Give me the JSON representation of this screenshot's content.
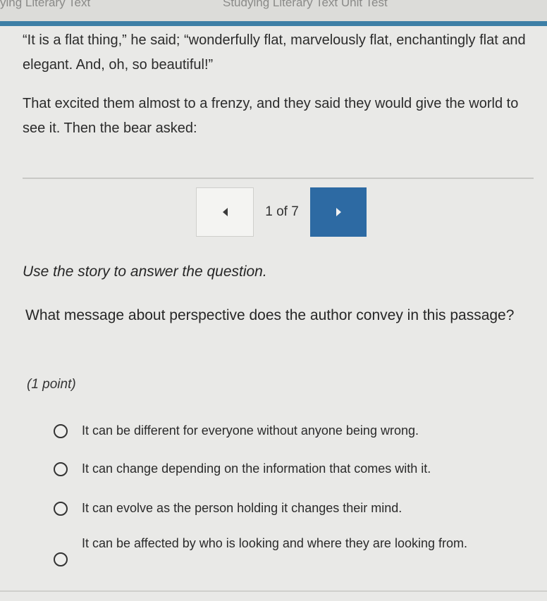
{
  "tabs": {
    "left": "ying Literary Text",
    "right": "Studying Literary Text Unit Test"
  },
  "passage": {
    "paragraph1": "“It is a flat thing,” he said; “wonderfully flat, marvelously flat, enchantingly flat and elegant. And, oh, so beautiful!”",
    "paragraph2": "That excited them almost to a frenzy, and they said they would give the world to see it. Then the bear asked:"
  },
  "pager": {
    "count": "1 of 7",
    "prev_icon": "triangle-left-icon",
    "next_icon": "triangle-right-icon"
  },
  "question": {
    "instruction": "Use the story to answer the question.",
    "prompt": "What message about perspective does the author convey in this passage?",
    "points": "(1 point)"
  },
  "options": [
    "It can be different for everyone without anyone being wrong.",
    "It can change depending on the information that comes with it.",
    "It can evolve as the person holding it changes their mind.",
    "It can be affected by who is looking and where they are looking from."
  ],
  "colors": {
    "accent": "#3d7fa6",
    "next_button": "#2d6aa3",
    "background": "#e9e9e7"
  }
}
